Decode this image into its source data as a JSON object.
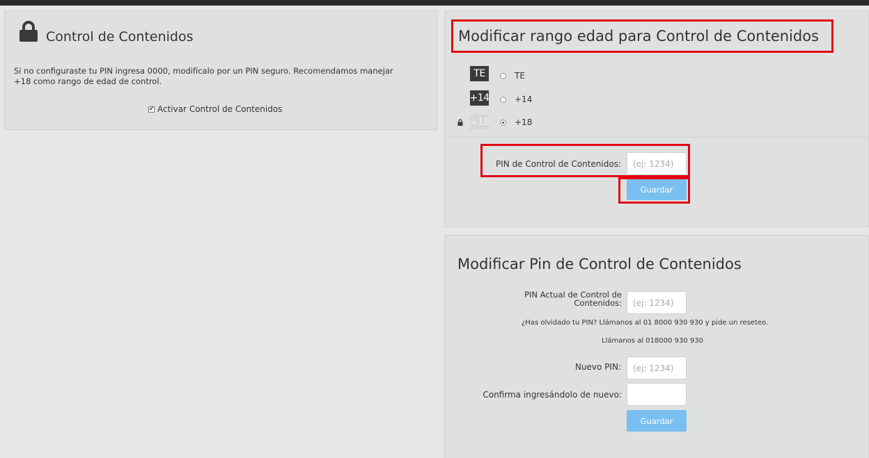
{
  "content_control": {
    "title": "Control de Contenidos",
    "description": "Si no configuraste tu PIN ingresa 0000, modifícalo por un PIN seguro. Recomendamos manejar +18 como rango de edad de control.",
    "activate_label": "Activar Control de Contenidos",
    "activate_checked": true
  },
  "age_range": {
    "title": "Modificar rango edad para Control de Contenidos",
    "options": [
      {
        "badge": "TE",
        "label": "TE",
        "selected": false,
        "locked": false
      },
      {
        "badge": "+14",
        "label": "+14",
        "selected": false,
        "locked": false
      },
      {
        "badge": "+18",
        "label": "+18",
        "selected": true,
        "locked": true
      }
    ],
    "pin_label": "PIN de Control de Contenidos:",
    "pin_placeholder": "(ej: 1234)",
    "save_label": "Guardar"
  },
  "change_pin": {
    "title": "Modificar Pin de Control de Contenidos",
    "current_pin_label": "PIN Actual de Control de Contenidos:",
    "current_pin_placeholder": "(ej: 1234)",
    "forgot_text": "¿Has olvidado tu PIN? Llámanos al 01 8000 930 930 y pide un reseteo.",
    "call_text": "Llámanos al 018000 930 930",
    "new_pin_label": "Nuevo PIN:",
    "new_pin_placeholder": "(ej: 1234)",
    "confirm_label": "Confirma ingresándolo de nuevo:",
    "confirm_value": "",
    "save_label": "Guardar"
  },
  "colors": {
    "background": "#e6e8e8",
    "panel": "#dfe1e1",
    "highlight": "#e30613",
    "button": "#79bff0",
    "badge": "#3a3a3a"
  },
  "icons": [
    "lock-icon",
    "small-lock-icon"
  ]
}
